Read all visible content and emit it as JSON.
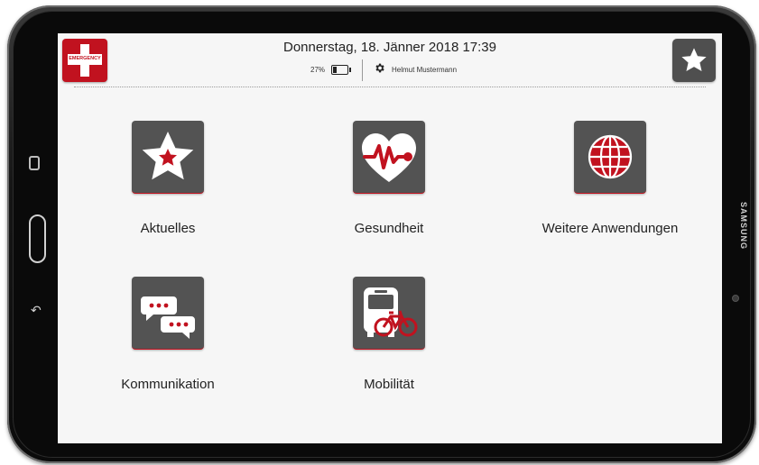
{
  "header": {
    "datetime": "Donnerstag, 18. Jänner 2018 17:39",
    "battery_text": "27%",
    "battery_level": 0.27,
    "user_name": "Helmut Mustermann",
    "emergency_label": "EMERGENCY"
  },
  "device": {
    "brand": "SAMSUNG"
  },
  "tiles": [
    {
      "label": "Aktuelles",
      "icon": "star-icon"
    },
    {
      "label": "Gesundheit",
      "icon": "heart-pulse-icon"
    },
    {
      "label": "Weitere Anwendungen",
      "icon": "globe-icon"
    },
    {
      "label": "Kommunikation",
      "icon": "chat-bubbles-icon"
    },
    {
      "label": "Mobilität",
      "icon": "bus-bicycle-icon"
    }
  ],
  "colors": {
    "accent": "#c1121f",
    "tile_bg": "#535353",
    "screen_bg": "#f6f6f6"
  }
}
